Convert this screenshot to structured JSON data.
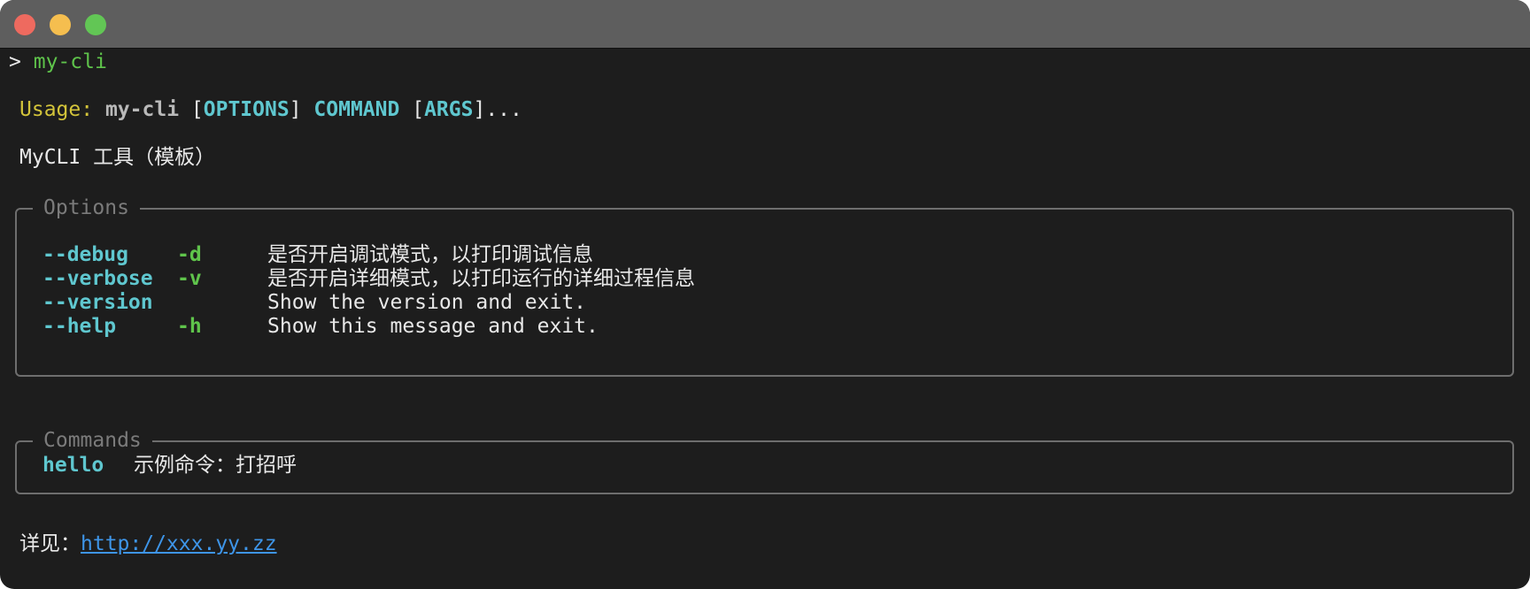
{
  "window": {
    "buttons": [
      "close",
      "minimize",
      "zoom"
    ]
  },
  "prompt": {
    "symbol": ">",
    "command": "my-cli"
  },
  "usage": {
    "label": "Usage:",
    "program": "my-cli",
    "open1": "[",
    "options": "OPTIONS",
    "close1": "]",
    "command": "COMMAND",
    "open2": "[",
    "args": "ARGS",
    "close2": "]..."
  },
  "description": "MyCLI 工具（模板）",
  "options_panel": {
    "title": "Options",
    "rows": [
      {
        "long": "--debug",
        "short": "-d",
        "help": "是否开启调试模式，以打印调试信息"
      },
      {
        "long": "--verbose",
        "short": "-v",
        "help": "是否开启详细模式，以打印运行的详细过程信息"
      },
      {
        "long": "--version",
        "short": "",
        "help": "Show the version and exit."
      },
      {
        "long": "--help",
        "short": "-h",
        "help": "Show this message and exit."
      }
    ]
  },
  "commands_panel": {
    "title": "Commands",
    "rows": [
      {
        "name": "hello",
        "help": "示例命令：打招呼"
      }
    ]
  },
  "footer": {
    "label": "详见：",
    "link": "http://xxx.yy.zz"
  },
  "colors": {
    "background": "#1d1d1d",
    "titlebar": "#5e5e5e",
    "green": "#5fc44b",
    "yellow": "#d3c43a",
    "cyan": "#5fc7cf",
    "link": "#3e95e8",
    "border": "#6e6e6e"
  }
}
